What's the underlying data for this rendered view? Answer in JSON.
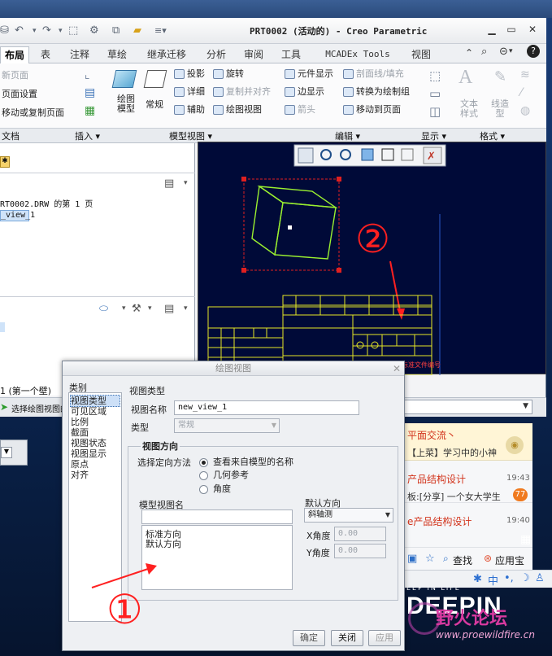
{
  "window": {
    "title": "PRT0002 (活动的) - Creo Parametric",
    "controls": [
      "minimize-icon",
      "restore-icon",
      "close-icon"
    ]
  },
  "tabs": [
    "布局",
    "表",
    "注释",
    "草绘",
    "继承迁移",
    "分析",
    "审阅",
    "工具",
    "MCADEx Tools",
    "视图"
  ],
  "ribbon": {
    "doc": {
      "items": [
        "新页面",
        "页面设置",
        "移动或复制页面"
      ],
      "group": "文档"
    },
    "insert": {
      "group": "插入 ▾"
    },
    "model_view": {
      "big": [
        "绘图\n模型",
        "常规"
      ],
      "col1": [
        "投影",
        "详细",
        "辅助"
      ],
      "col2": [
        "旋转",
        "复制并对齐",
        "绘图视图"
      ],
      "group": "模型视图 ▾"
    },
    "edit": {
      "col1": [
        "元件显示",
        "边显示",
        "箭头"
      ],
      "col2": [
        "剖面线/填充",
        "转换为绘制组",
        "移动到页面"
      ],
      "group": "编辑 ▾"
    },
    "display": {
      "group": "显示 ▾"
    },
    "format": {
      "big": [
        "文本\n样式",
        "线造\n型"
      ],
      "group": "格式 ▾"
    }
  },
  "left_panel": {
    "page_info": "RT0002.DRW 的第 1 页",
    "selected_item": "_view_1",
    "footer_item": "1 (第一个壁)"
  },
  "status": {
    "hint": "选择绘图视图的"
  },
  "canvas": {
    "annotation_2": "②",
    "title_block_text": "视图名称正式标准文件编号"
  },
  "chat": {
    "items": [
      {
        "title": "平面交流丶",
        "text": "【上菜】学习中的小神"
      },
      {
        "title": "产品结构设计",
        "time": "19:43",
        "text": "板:[分享] 一个女大学生",
        "badge": "77"
      },
      {
        "title": "e产品结构设计",
        "time": "19:40"
      }
    ],
    "search": "查找",
    "appstore": "应用宝",
    "ime": "中"
  },
  "watermark": {
    "brand": "DEEPIN",
    "forum": "野火论坛",
    "url": "www.proewildfire.cn",
    "tagline": "EEP IN LIFE"
  },
  "dialog": {
    "title": "绘图视图",
    "category_label": "类别",
    "categories": [
      "视图类型",
      "可见区域",
      "比例",
      "截面",
      "视图状态",
      "视图显示",
      "原点",
      "对齐"
    ],
    "view_type_label": "视图类型",
    "view_name_label": "视图名称",
    "view_name_value": "new_view_1",
    "type_label": "类型",
    "type_value": "常规",
    "orientation_header": "视图方向",
    "orientation_method_label": "选择定向方法",
    "orientation_options": [
      "查看来自模型的名称",
      "几何参考",
      "角度"
    ],
    "orientation_selected": 0,
    "model_view_name_label": "模型视图名",
    "model_view_names": [
      "标准方向",
      "默认方向"
    ],
    "default_orientation_label": "默认方向",
    "default_orientation_value": "斜轴测",
    "x_angle_label": "X角度",
    "x_angle_value": "0.00",
    "y_angle_label": "Y角度",
    "y_angle_value": "0.00",
    "buttons": [
      "确定",
      "关闭",
      "应用"
    ],
    "annotation_1": "①"
  }
}
